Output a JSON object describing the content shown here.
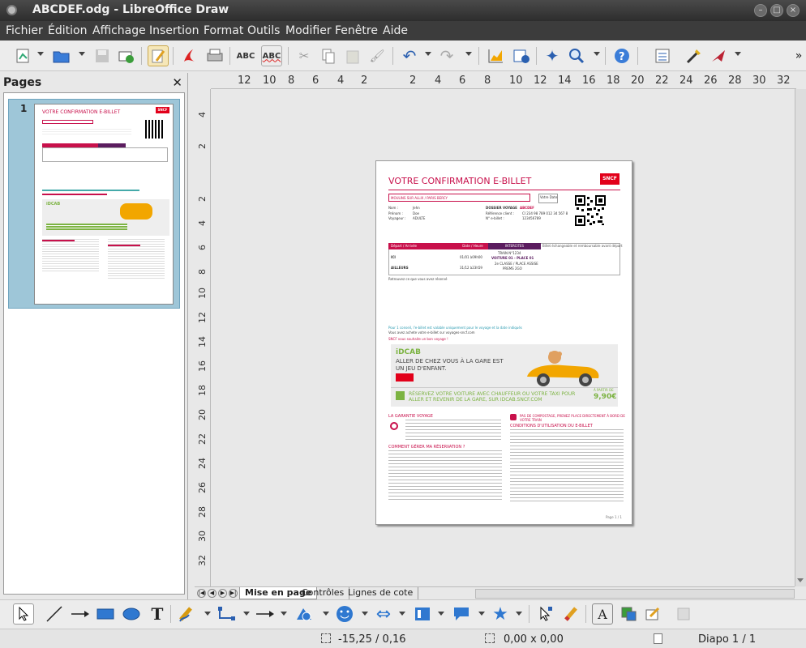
{
  "window": {
    "title": "ABCDEF.odg - LibreOffice Draw"
  },
  "menu": [
    "Fichier",
    "Édition",
    "Affichage",
    "Insertion",
    "Format",
    "Outils",
    "Modifier",
    "Fenêtre",
    "Aide"
  ],
  "pages_panel": {
    "title": "Pages",
    "page_number": "1"
  },
  "rulers": {
    "h": [
      "12",
      "10",
      "8",
      "6",
      "4",
      "2",
      "2",
      "4",
      "6",
      "8",
      "10",
      "12",
      "14",
      "16",
      "18",
      "20",
      "22",
      "24",
      "26",
      "28",
      "30",
      "32"
    ],
    "v_top": [
      "4",
      "2"
    ],
    "v": [
      "2",
      "4",
      "6",
      "8",
      "10",
      "12",
      "14",
      "16",
      "18",
      "20",
      "22",
      "24",
      "26",
      "28",
      "30",
      "32"
    ]
  },
  "doc": {
    "title": "VOTRE CONFIRMATION E-BILLET",
    "brand": "SNCF",
    "route": "MOULINS SUR ALLIX / PARIS BERCY",
    "date_label": "Votre Date",
    "nom_label": "Nom :",
    "nom": "Jehn",
    "prenom_label": "Prénom :",
    "prenom": "Doe",
    "voyageur_label": "Voyageur :",
    "voyageur": "ADULTE",
    "dossier_label": "DOSSIER VOYAGE",
    "dossier": "ABCDEF",
    "ref_label": "Référence client :",
    "ref": "CI 234 98 789 012 34 567 8",
    "n_label": "N° e-billet :",
    "n": "123456789",
    "col_depart": "Départ / Arrivée",
    "col_date": "Date / Heure",
    "col_inter": "INTERCITES",
    "ici": "ICI",
    "ailleurs": "AILLEURS",
    "date1": "01/01 à09h00",
    "date2": "31/12 à23h59",
    "train": "TRAIN N°1234",
    "voiture": "VOITURE 01 - PLACE 01",
    "classe": "2e CLASSE / PLACE ASSISE",
    "tarif": "PREMS 2GO",
    "note1": "Billet échangeable et remboursable avant départ",
    "note2": "Retrouvez ce que vous avez réservé",
    "green1": "Pour 1 conseil, l'e-billet est valable uniquement pour le voyage et la date indiqués",
    "green2": "Vous avez achete votre e-billet sur voyages-sncf.com",
    "pink1": "SNCF vous souhaite un bon voyage !",
    "idcab": "iDCAB",
    "idcab_sub": "ALLER DE CHEZ VOUS À LA GARE EST UN JEU D'ENFANT.",
    "idcab_green": "RÉSERVEZ VOTRE VOITURE AVEC CHAUFFEUR OU VOTRE TAXI POUR ALLER ET REVENIR DE LA GARE, SUR IDCAB.SNCF.COM",
    "price_label": "À PARTIR DE",
    "price": "9,90€",
    "garantie": "LA GARANTIE VOYAGE",
    "gerer": "COMMENT GÉRER MA RÉSERVATION ?",
    "pas_compostage": "PAS DE COMPOSTAGE, PRENEZ PLACE DIRECTEMENT À BORD DE VOTRE TRAIN",
    "conditions": "CONDITIONS D'UTILISATION DU E-BILLET",
    "page_footer": "Page 1 / 1"
  },
  "tabs": [
    "Mise en page",
    "Contrôles",
    "Lignes de cote"
  ],
  "status": {
    "position": "-15,25 / 0,16",
    "size": "0,00 x 0,00",
    "slide": "Diapo 1 / 1"
  },
  "colors": {
    "accent": "#c8104b",
    "purple": "#5b1c5f",
    "green": "#7cb342",
    "brand": "#e2001a"
  }
}
